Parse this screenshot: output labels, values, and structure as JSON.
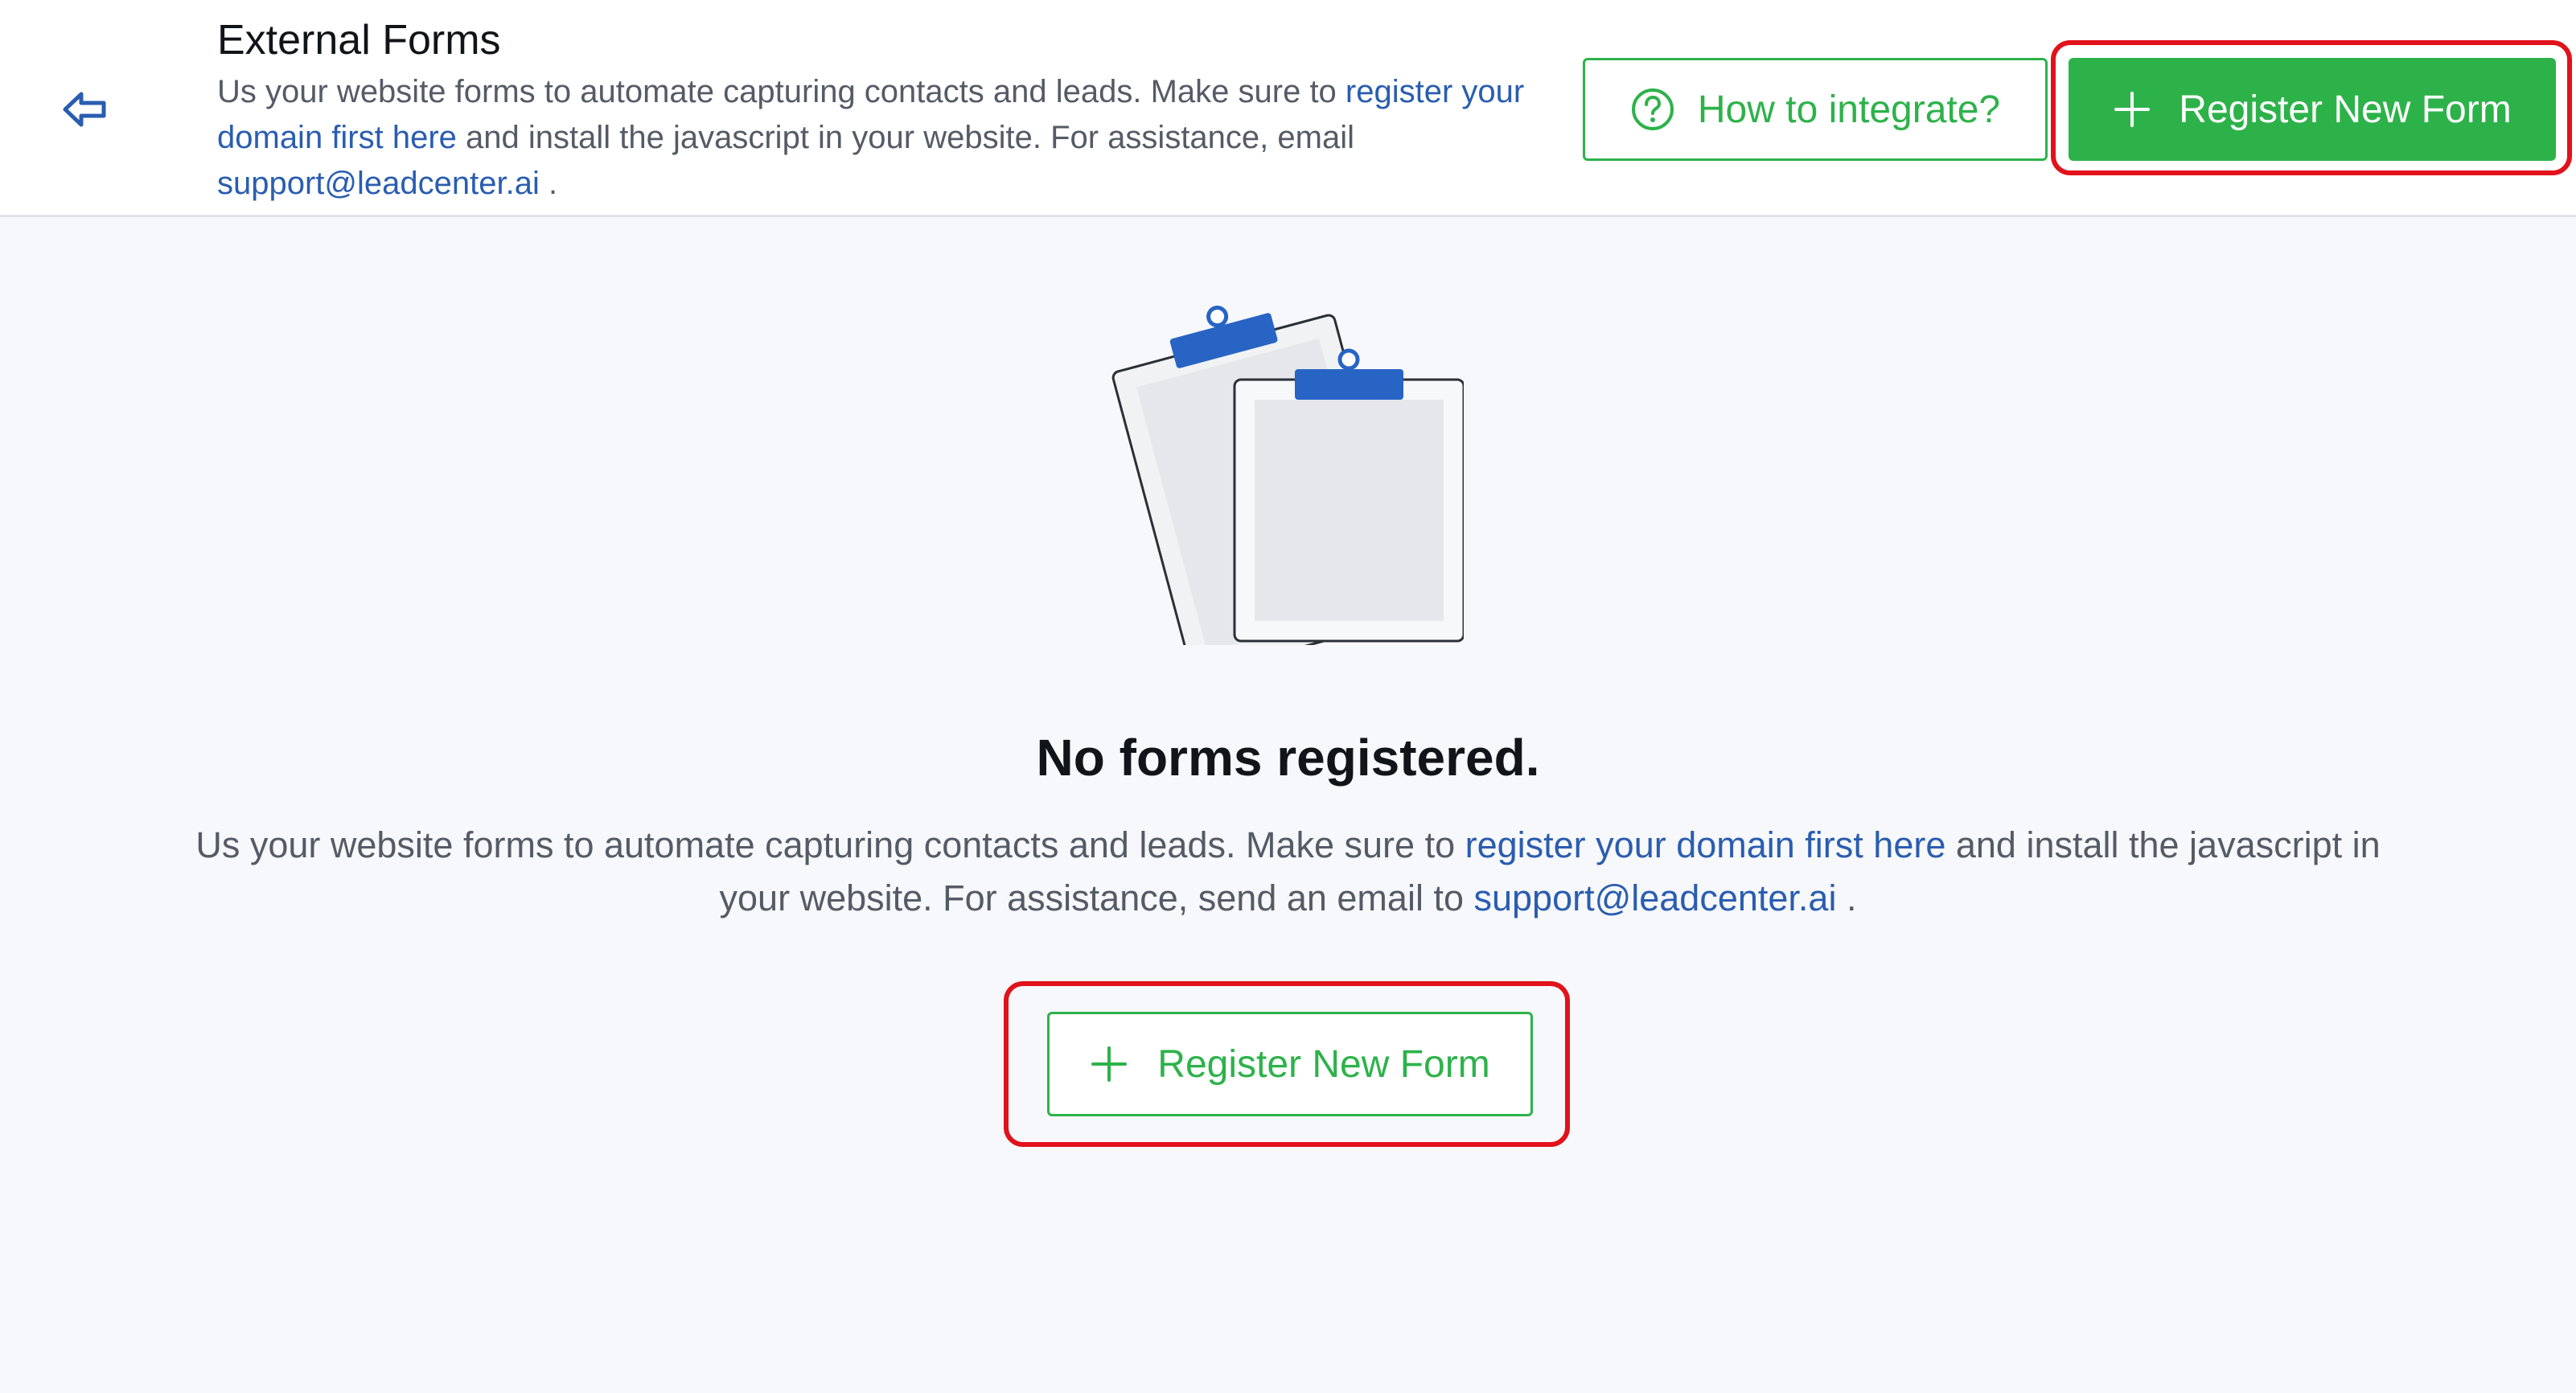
{
  "header": {
    "title": "External Forms",
    "desc_prefix": "Us your website forms to automate capturing contacts and leads. Make sure to ",
    "desc_link": "register your domain first here",
    "desc_middle": " and install the javascript in your website. For assistance, email ",
    "desc_email": "support@leadcenter.ai",
    "desc_suffix": " ."
  },
  "toolbar": {
    "integrate_label": "How to integrate?",
    "register_label": "Register New Form"
  },
  "empty_state": {
    "title": "No forms registered.",
    "desc_prefix": "Us your website forms to automate capturing contacts and leads. Make sure to ",
    "desc_link": "register your domain first here",
    "desc_middle": " and install the javascript in your website. For assistance, send an email to ",
    "desc_email": "support@leadcenter.ai",
    "desc_suffix": " .",
    "button_label": "Register New Form"
  },
  "icons": {
    "back": "back-arrow-icon",
    "help": "question-circle-icon",
    "plus": "plus-icon",
    "illustration": "clipboards-illustration"
  },
  "colors": {
    "accent_green": "#2db24a",
    "link_blue": "#2a5db0",
    "clip_blue": "#2764c4",
    "annotation_red": "#e1121b"
  }
}
